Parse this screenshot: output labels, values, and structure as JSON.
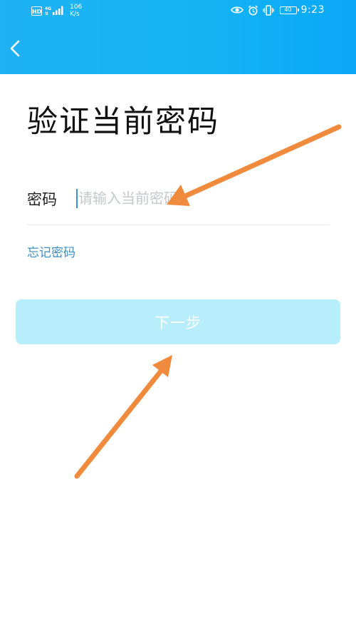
{
  "status_bar": {
    "hd": "HD",
    "network": "4G",
    "network_sub": "⇅",
    "speed_value": "106",
    "speed_unit": "K/s",
    "battery": "40",
    "time": "9:23"
  },
  "header": {
    "back_icon": "chevron-left-icon"
  },
  "page": {
    "title": "验证当前密码",
    "password_label": "密码",
    "password_value": "",
    "password_placeholder": "请输入当前密码",
    "forgot_link": "忘记密码",
    "next_button": "下一步"
  },
  "colors": {
    "header_gradient_start": "#1fb2f4",
    "header_gradient_end": "#0aa8f7",
    "link": "#3a8fc8",
    "button_disabled": "#b8edfb",
    "annotation_arrow": "#f08a3c"
  }
}
